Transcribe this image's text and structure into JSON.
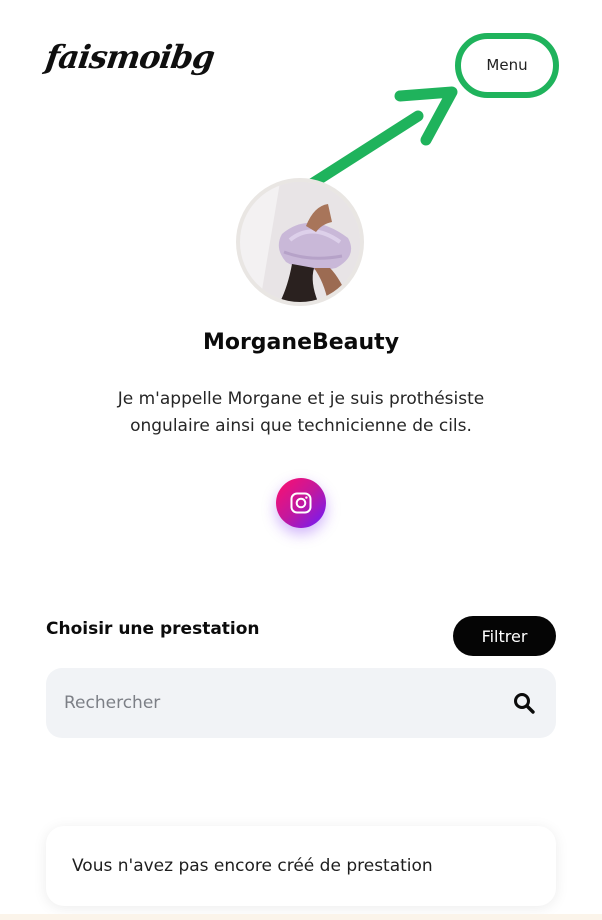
{
  "header": {
    "logo_text": "faismoibg",
    "menu_label": "Menu"
  },
  "profile": {
    "name": "MorganeBeauty",
    "bio": "Je m'appelle Morgane et je suis prothésiste ongulaire ainsi que technicienne de cils.",
    "social_icon": "instagram-icon"
  },
  "services": {
    "title": "Choisir une prestation",
    "filter_label": "Filtrer",
    "search": {
      "placeholder": "Rechercher",
      "value": ""
    },
    "empty_message": "Vous n'avez pas encore créé de prestation"
  },
  "colors": {
    "annotation_green": "#1fb35c",
    "filter_bg": "#050505",
    "search_bg": "#f1f3f6",
    "instagram_gradient": [
      "#ff0f6b",
      "#c2189e",
      "#6a1cff"
    ]
  }
}
